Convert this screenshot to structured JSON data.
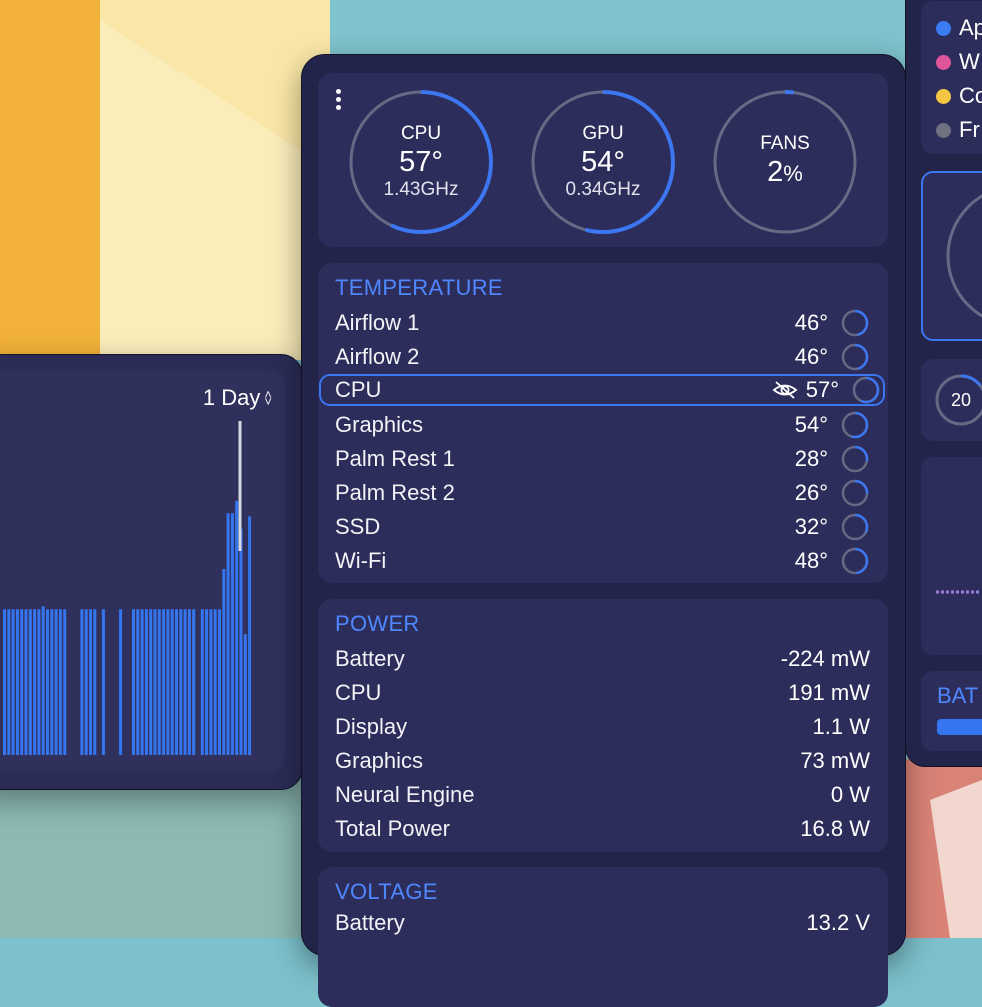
{
  "history_panel": {
    "range_label": "1 Day",
    "bar_color": "#3575f0",
    "marker_color": "#d8d8e0",
    "bars": [
      0.47,
      0.47,
      0.47,
      0.47,
      0.47,
      0.47,
      0.47,
      0.47,
      0.47,
      0.48,
      0.47,
      0.47,
      0.47,
      0.47,
      0.47,
      0,
      0,
      0,
      0.47,
      0.47,
      0.47,
      0.47,
      0,
      0.47,
      0,
      0,
      0,
      0.47,
      0,
      0,
      0.47,
      0.47,
      0.47,
      0.47,
      0.47,
      0.47,
      0.47,
      0.47,
      0.47,
      0.47,
      0.47,
      0.47,
      0.47,
      0.47,
      0.47,
      0,
      0.47,
      0.47,
      0.47,
      0.47,
      0.47,
      0.6,
      0.78,
      0.78,
      0.82,
      0.73,
      0.39,
      0.77
    ]
  },
  "gauges": {
    "cpu": {
      "label": "CPU",
      "value": "57°",
      "sub": "1.43GHz",
      "fraction": 0.57
    },
    "gpu": {
      "label": "GPU",
      "value": "54°",
      "sub": "0.34GHz",
      "fraction": 0.54
    },
    "fans": {
      "label": "FANS",
      "value": "2",
      "unit": "%",
      "fraction": 0.02
    }
  },
  "temperature": {
    "title": "TEMPERATURE",
    "rows": [
      {
        "label": "Airflow 1",
        "value": "46°",
        "fraction": 0.46
      },
      {
        "label": "Airflow 2",
        "value": "46°",
        "fraction": 0.46
      },
      {
        "label": "CPU",
        "value": "57°",
        "fraction": 0.57
      },
      {
        "label": "Graphics",
        "value": "54°",
        "fraction": 0.54
      },
      {
        "label": "Palm Rest 1",
        "value": "28°",
        "fraction": 0.28
      },
      {
        "label": "Palm Rest 2",
        "value": "26°",
        "fraction": 0.26
      },
      {
        "label": "SSD",
        "value": "32°",
        "fraction": 0.32
      },
      {
        "label": "Wi-Fi",
        "value": "48°",
        "fraction": 0.48
      }
    ]
  },
  "power": {
    "title": "POWER",
    "rows": [
      {
        "label": "Battery",
        "value": "-224 mW"
      },
      {
        "label": "CPU",
        "value": "191 mW"
      },
      {
        "label": "Display",
        "value": "1.1 W"
      },
      {
        "label": "Graphics",
        "value": "73 mW"
      },
      {
        "label": "Neural Engine",
        "value": "0 W"
      },
      {
        "label": "Total Power",
        "value": "16.8 W"
      }
    ]
  },
  "voltage": {
    "title": "VOLTAGE",
    "rows": [
      {
        "label": "Battery",
        "value": "13.2 V"
      }
    ]
  },
  "right_panel": {
    "legend": [
      {
        "label": "Ap",
        "color": "#3b7cf5"
      },
      {
        "label": "W",
        "color": "#e0559a"
      },
      {
        "label": "Co",
        "color": "#f4c542"
      },
      {
        "label": "Fr",
        "color": "#6f7080"
      }
    ],
    "small_gauge_value": "20",
    "battery_title": "BAT"
  },
  "colors": {
    "accent": "#3c76f0",
    "ring_track": "#676985",
    "section_title": "#4f87ff",
    "panel_bg": "#232449",
    "card_bg": "#2c2d5a"
  }
}
